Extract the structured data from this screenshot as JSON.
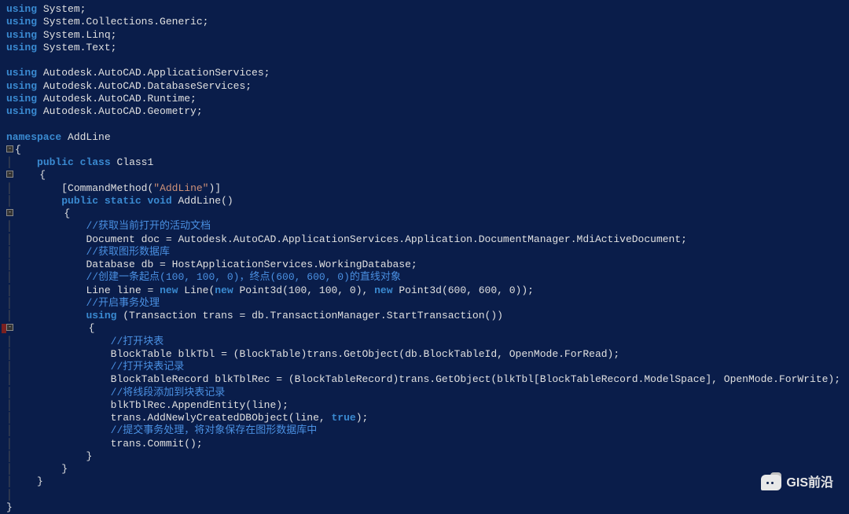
{
  "code": {
    "u1": "using",
    "u2": "using",
    "u3": "using",
    "u4": "using",
    "u5": "using",
    "u6": "using",
    "u7": "using",
    "u8": "using",
    "ns1": " System;",
    "ns2": " System.Collections.Generic;",
    "ns3": " System.Linq;",
    "ns4": " System.Text;",
    "ns5": " Autodesk.AutoCAD.ApplicationServices;",
    "ns6": " Autodesk.AutoCAD.DatabaseServices;",
    "ns7": " Autodesk.AutoCAD.Runtime;",
    "ns8": " Autodesk.AutoCAD.Geometry;",
    "nskw": "namespace",
    "nsname": " AddLine",
    "ob": "{",
    "cb": "}",
    "pub": "public",
    "cls": "class",
    "clsname": " Class1",
    "attr1": "[CommandMethod(",
    "attr_str": "\"AddLine\"",
    "attr2": ")]",
    "static": "static",
    "void": "void",
    "method": " AddLine()",
    "c1": "//获取当前打开的活动文档",
    "l_doc": "Document doc = Autodesk.AutoCAD.ApplicationServices.Application.DocumentManager.MdiActiveDocument;",
    "c2": "//获取图形数据库",
    "l_db": "Database db = HostApplicationServices.WorkingDatabase;",
    "c3": "//创建一条起点(100, 100, 0)，终点(600, 600, 0)的直线对象",
    "l_line1": "Line line = ",
    "new1": "new",
    "l_line2": " Line(",
    "new2": "new",
    "l_line3": " Point3d(100, 100, 0), ",
    "new3": "new",
    "l_line4": " Point3d(600, 600, 0));",
    "c4": "//开启事务处理",
    "usingkw": "using",
    "l_trans": " (Transaction trans = db.TransactionManager.StartTransaction())",
    "c5": "//打开块表",
    "l_bt": "BlockTable blkTbl = (BlockTable)trans.GetObject(db.BlockTableId, OpenMode.ForRead);",
    "c6": "//打开块表记录",
    "l_btr": "BlockTableRecord blkTblRec = (BlockTableRecord)trans.GetObject(blkTbl[BlockTableRecord.ModelSpace], OpenMode.ForWrite);",
    "c7": "//将线段添加到块表记录",
    "l_app": "blkTblRec.AppendEntity(line);",
    "l_add1": "trans.AddNewlyCreatedDBObject(line, ",
    "true": "true",
    "l_add2": ");",
    "c8": "//提交事务处理，将对象保存在图形数据库中",
    "l_commit": "trans.Commit();"
  },
  "watermark": "GIS前沿"
}
